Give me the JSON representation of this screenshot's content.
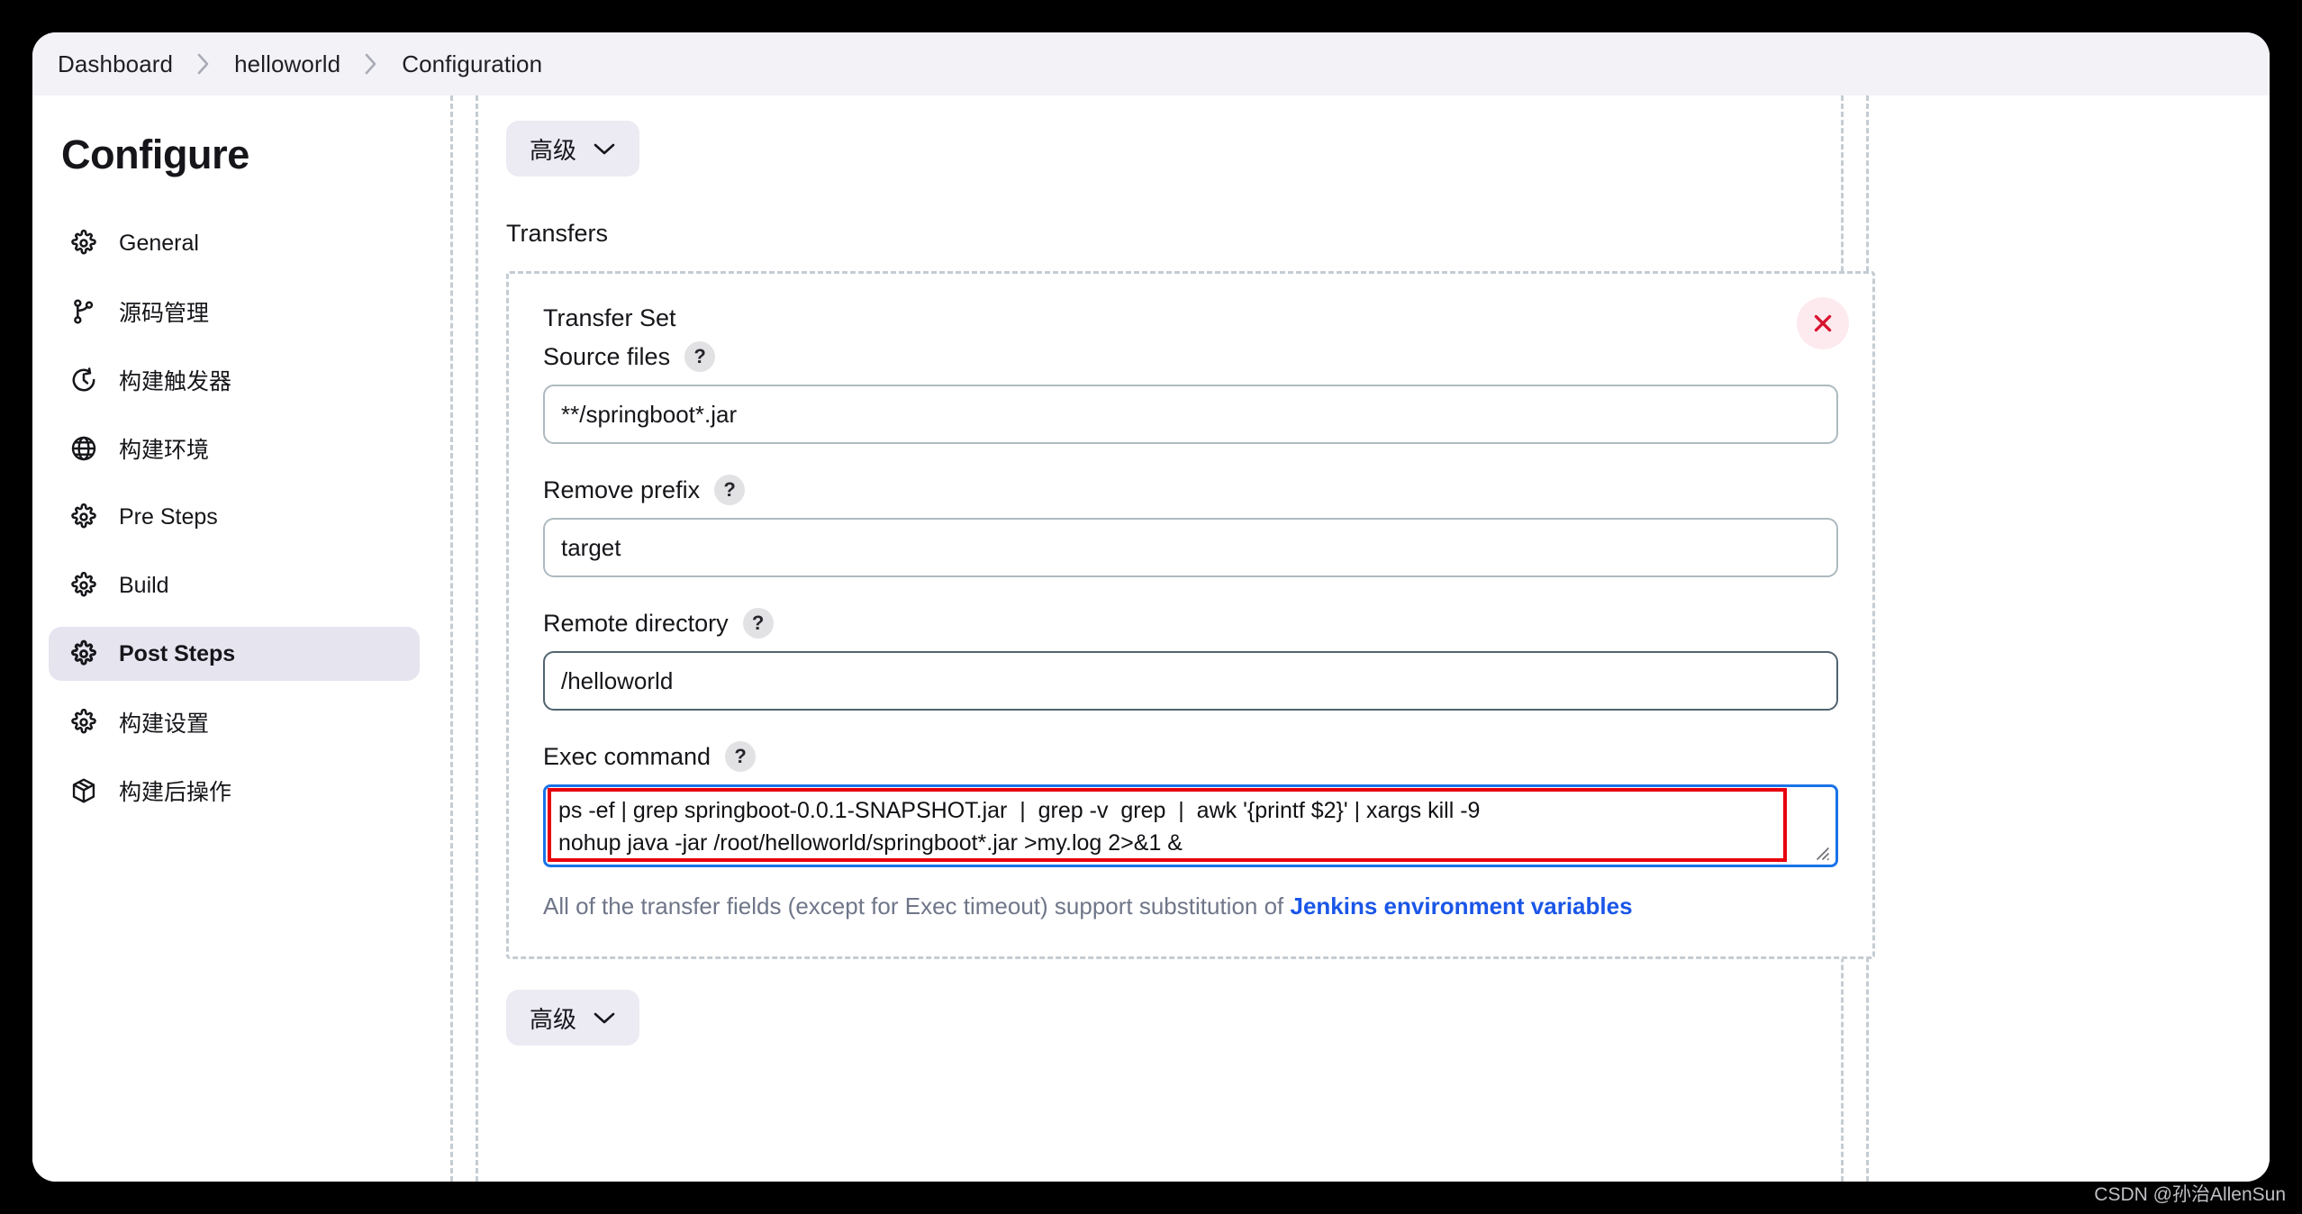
{
  "breadcrumb": {
    "items": [
      {
        "label": "Dashboard"
      },
      {
        "label": "helloworld"
      },
      {
        "label": "Configuration"
      }
    ],
    "separator_icon": "chevron-right-icon"
  },
  "sidebar": {
    "title": "Configure",
    "items": [
      {
        "label": "General",
        "icon": "gear-icon",
        "active": false
      },
      {
        "label": "源码管理",
        "icon": "branch-icon",
        "active": false
      },
      {
        "label": "构建触发器",
        "icon": "clock-icon",
        "active": false
      },
      {
        "label": "构建环境",
        "icon": "globe-icon",
        "active": false
      },
      {
        "label": "Pre Steps",
        "icon": "gear-icon",
        "active": false
      },
      {
        "label": "Build",
        "icon": "gear-icon",
        "active": false
      },
      {
        "label": "Post Steps",
        "icon": "gear-icon",
        "active": true
      },
      {
        "label": "构建设置",
        "icon": "gear-icon",
        "active": false
      },
      {
        "label": "构建后操作",
        "icon": "package-icon",
        "active": false
      }
    ]
  },
  "main": {
    "top_advanced_button": {
      "label": "高级",
      "icon": "chevron-down-icon"
    },
    "transfers_heading": "Transfers",
    "transfer_set": {
      "title": "Transfer Set",
      "close_icon": "close-icon",
      "fields": [
        {
          "label": "Source files",
          "help_icon": "help-icon",
          "value": "**/springboot*.jar",
          "focused": false
        },
        {
          "label": "Remove prefix",
          "help_icon": "help-icon",
          "value": "target",
          "focused": false
        },
        {
          "label": "Remote directory",
          "help_icon": "help-icon",
          "value": "/helloworld",
          "focused": true
        }
      ],
      "exec_command": {
        "label": "Exec command",
        "help_icon": "help-icon",
        "value": "ps -ef | grep springboot-0.0.1-SNAPSHOT.jar  |  grep -v  grep  |  awk '{printf $2}' | xargs kill -9\nnohup java -jar /root/helloworld/springboot*.jar >my.log 2>&1 &",
        "resize_grip_icon": "resize-grip-icon"
      },
      "hint": {
        "text_before": "All of the transfer fields (except for Exec timeout) support substitution of ",
        "link_text": "Jenkins environment variables"
      }
    },
    "bottom_advanced_button": {
      "label": "高级",
      "icon": "chevron-down-icon"
    }
  },
  "watermark": "CSDN @孙治AllenSun",
  "colors": {
    "accent_blue": "#1a73e8",
    "annotation_red": "#e8000d",
    "link_blue": "#1a56e8",
    "active_nav_bg": "#e6e4ef",
    "close_red": "#d8132f"
  }
}
